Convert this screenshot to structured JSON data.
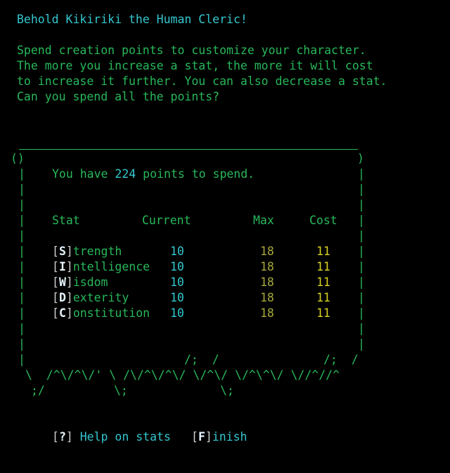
{
  "intro": {
    "title": "Behold Kikiriki the Human Cleric!",
    "line1": "Spend creation points to customize your character.",
    "line2": "The more you increase a stat, the more it will cost",
    "line3": "to increase it further. You can also decrease a stat.",
    "line4": "Can you spend all the points?"
  },
  "panel": {
    "points_prefix": "You have",
    "points": "224",
    "points_suffix": "points to spend.",
    "headers": {
      "stat": "Stat",
      "current": "Current",
      "max": "Max",
      "cost": "Cost"
    },
    "stats": [
      {
        "key": "S",
        "rest": "trength",
        "current": "10",
        "max": "18",
        "cost": "11"
      },
      {
        "key": "I",
        "rest": "ntelligence",
        "current": "10",
        "max": "18",
        "cost": "11"
      },
      {
        "key": "W",
        "rest": "isdom",
        "current": "10",
        "max": "18",
        "cost": "11"
      },
      {
        "key": "D",
        "rest": "exterity",
        "current": "10",
        "max": "18",
        "cost": "11"
      },
      {
        "key": "C",
        "rest": "onstitution",
        "current": "10",
        "max": "18",
        "cost": "11"
      }
    ],
    "art_row1_a": "/;  /",
    "art_row1_b": "/;  /",
    "art_row2": "\\  /^\\/^\\/' \\ /\\/^\\/^\\/ \\/^\\/ \\/^\\^\\/ \\//^//^",
    "art_row3_a": ";/",
    "art_row3_b": "\\;",
    "art_row3_c": "\\;"
  },
  "footer": {
    "help_key": "?",
    "help_label": "Help on stats",
    "finish_key": "F",
    "finish_rest": "inish"
  },
  "colors": {
    "text": "#28b85a",
    "accent": "#33c7cf",
    "max": "#a8a83a",
    "cost": "#d9d21f",
    "background": "#000000"
  }
}
